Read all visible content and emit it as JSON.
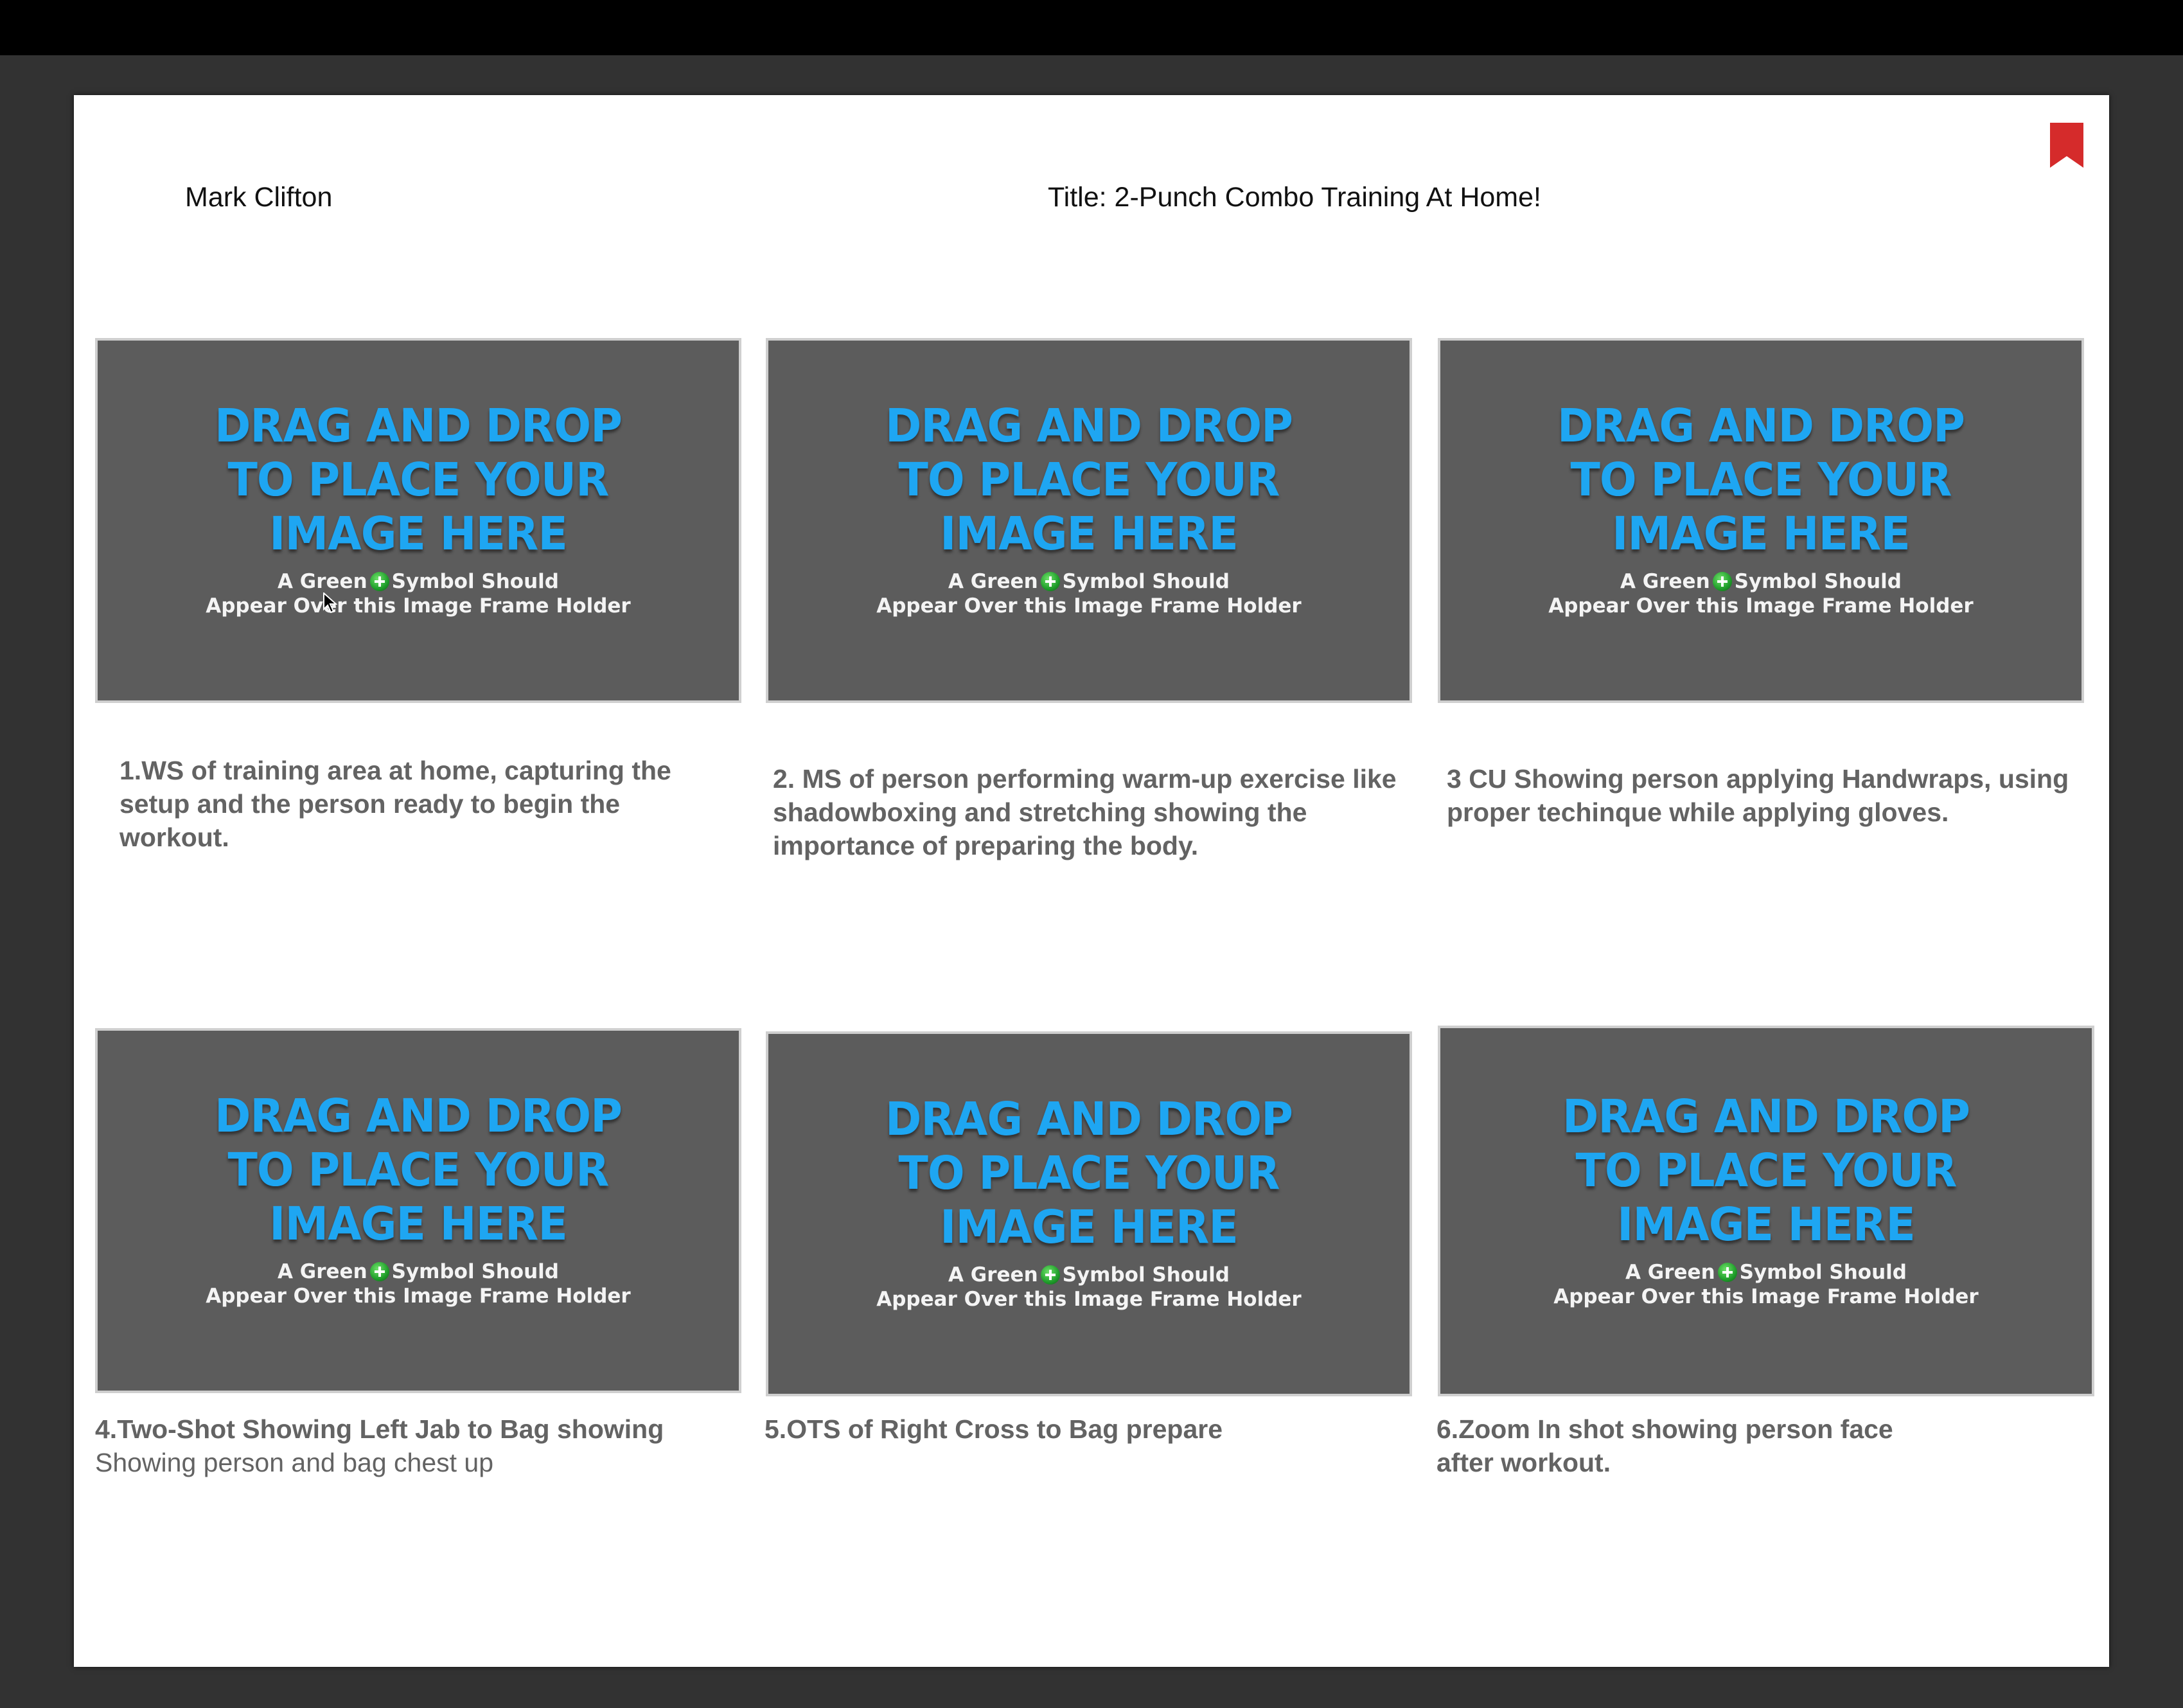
{
  "document": {
    "author": "Mark Clifton",
    "title": "Title: 2-Punch Combo Training At Home!"
  },
  "icons": {
    "bookmark": "bookmark-icon",
    "plus": "green-plus-icon",
    "cursor": "text-cursor-icon"
  },
  "colors": {
    "bookmark": "#d52b2b",
    "heading": "#1ea6f2",
    "frame": "#5c5c5c",
    "caption": "#636363"
  },
  "placeholder": {
    "heading": "DRAG AND DROP\nTO PLACE YOUR\nIMAGE HERE",
    "sub_before": "A Green",
    "sub_after": "Symbol Should",
    "sub_line2": "Appear Over this Image Frame Holder"
  },
  "frames": [
    {
      "caption_bold": "1.WS of training area at home, capturing the setup and the person ready to begin the workout.",
      "caption_normal": ""
    },
    {
      "caption_bold": "2. MS of person performing warm-up exercise like shadowboxing and stretching showing the importance of preparing the body.",
      "caption_normal": ""
    },
    {
      "caption_bold": "3 CU Showing person applying Handwraps, using proper techinque while applying gloves.",
      "caption_normal": ""
    },
    {
      "caption_bold": "4.Two-Shot Showing Left Jab to Bag showing",
      "caption_normal": "Showing person and bag chest up"
    },
    {
      "caption_bold": "5.OTS of Right Cross to Bag prepare",
      "caption_normal": ""
    },
    {
      "caption_bold": "6.Zoom In shot showing person face after workout.",
      "caption_normal": ""
    }
  ]
}
